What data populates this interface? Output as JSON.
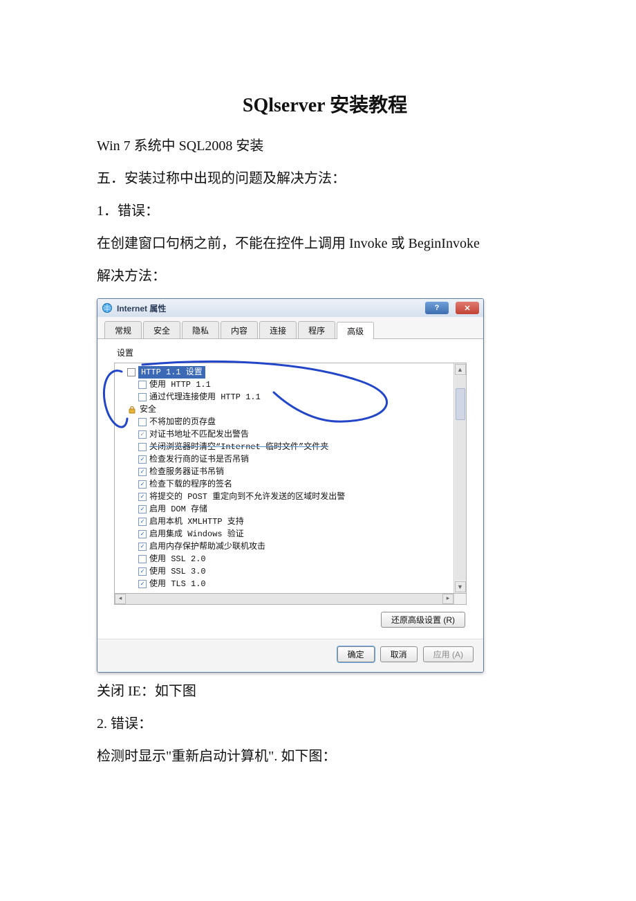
{
  "doc": {
    "title": "SQlserver 安装教程",
    "p1": "Win 7 系统中 SQL2008 安装",
    "p2": "五．安装过称中出现的问题及解决方法：",
    "p3": "1．错误：",
    "p4": "在创建窗口句柄之前，不能在控件上调用 Invoke 或 BeginInvoke",
    "p5": "解决方法：",
    "p6": "关闭 IE：如下图",
    "p7": "2. 错误：",
    "p8": "检测时显示\"重新启动计算机\". 如下图："
  },
  "dialog": {
    "window_title": "Internet 属性",
    "help_glyph": "?",
    "close_glyph": "✕",
    "tabs": {
      "general": "常规",
      "security": "安全",
      "privacy": "隐私",
      "content": "内容",
      "connections": "连接",
      "programs": "程序",
      "advanced": "高级"
    },
    "settings_label": "设置",
    "groups": {
      "http": "HTTP 1.1 设置",
      "security": "安全"
    },
    "items": {
      "http_use11": {
        "label": "使用 HTTP 1.1",
        "checked": false
      },
      "http_proxy11": {
        "label": "通过代理连接使用 HTTP 1.1",
        "checked": false
      },
      "sec_no_cache_enc": {
        "label": "不将加密的页存盘",
        "checked": false
      },
      "sec_cert_mismatch": {
        "label": "对证书地址不匹配发出警告",
        "checked": "semi"
      },
      "sec_clear_temp": {
        "label": "关闭浏览器时清空“Internet 临时文件”文件夹",
        "checked": false
      },
      "sec_pub_revoke": {
        "label": "检查发行商的证书是否吊销",
        "checked": true
      },
      "sec_srv_revoke": {
        "label": "检查服务器证书吊销",
        "checked": true
      },
      "sec_dl_sign": {
        "label": "检查下载的程序的签名",
        "checked": true
      },
      "sec_post_redirect": {
        "label": "将提交的 POST 重定向到不允许发送的区域时发出警",
        "checked": true
      },
      "sec_dom_storage": {
        "label": "启用 DOM 存储",
        "checked": true
      },
      "sec_xmlhttp": {
        "label": "启用本机 XMLHTTP 支持",
        "checked": true
      },
      "sec_iwa": {
        "label": "启用集成 Windows 验证",
        "checked": true
      },
      "sec_mem_protect": {
        "label": "启用内存保护帮助减少联机攻击",
        "checked": true
      },
      "sec_ssl20": {
        "label": "使用 SSL 2.0",
        "checked": false
      },
      "sec_ssl30": {
        "label": "使用 SSL 3.0",
        "checked": true
      },
      "sec_tls10": {
        "label": "使用 TLS 1.0",
        "checked": true
      }
    },
    "restore_btn": "还原高级设置 (R)",
    "ok": "确定",
    "cancel": "取消",
    "apply": "应用 (A)"
  }
}
